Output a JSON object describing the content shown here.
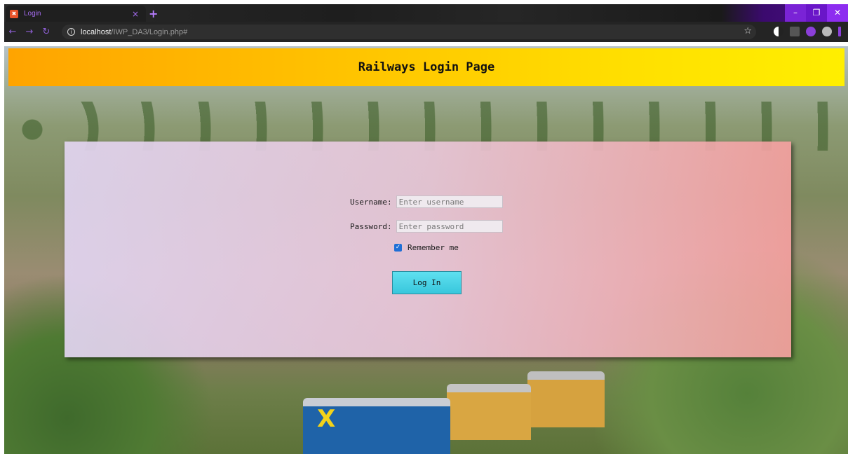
{
  "browser": {
    "tab_title": "Login",
    "tab_favicon": "xampp-icon",
    "new_tab_symbol": "+",
    "close_tab_symbol": "×",
    "url_host": "localhost",
    "url_path": "/IWP_DA3/Login.php#",
    "window_controls": {
      "minimize": "–",
      "restore": "❐",
      "close": "✕"
    }
  },
  "header": {
    "title": "Railways Login Page"
  },
  "form": {
    "username_label": "Username:",
    "username_placeholder": "Enter username",
    "password_label": "Password:",
    "password_placeholder": "Enter password",
    "remember_label": "Remember me",
    "remember_checked": true,
    "submit_label": "Log In"
  },
  "colors": {
    "banner_start": "#ffa400",
    "banner_end": "#ffef00",
    "button": "#38c7dc",
    "browser_accent": "#6a16c8"
  }
}
